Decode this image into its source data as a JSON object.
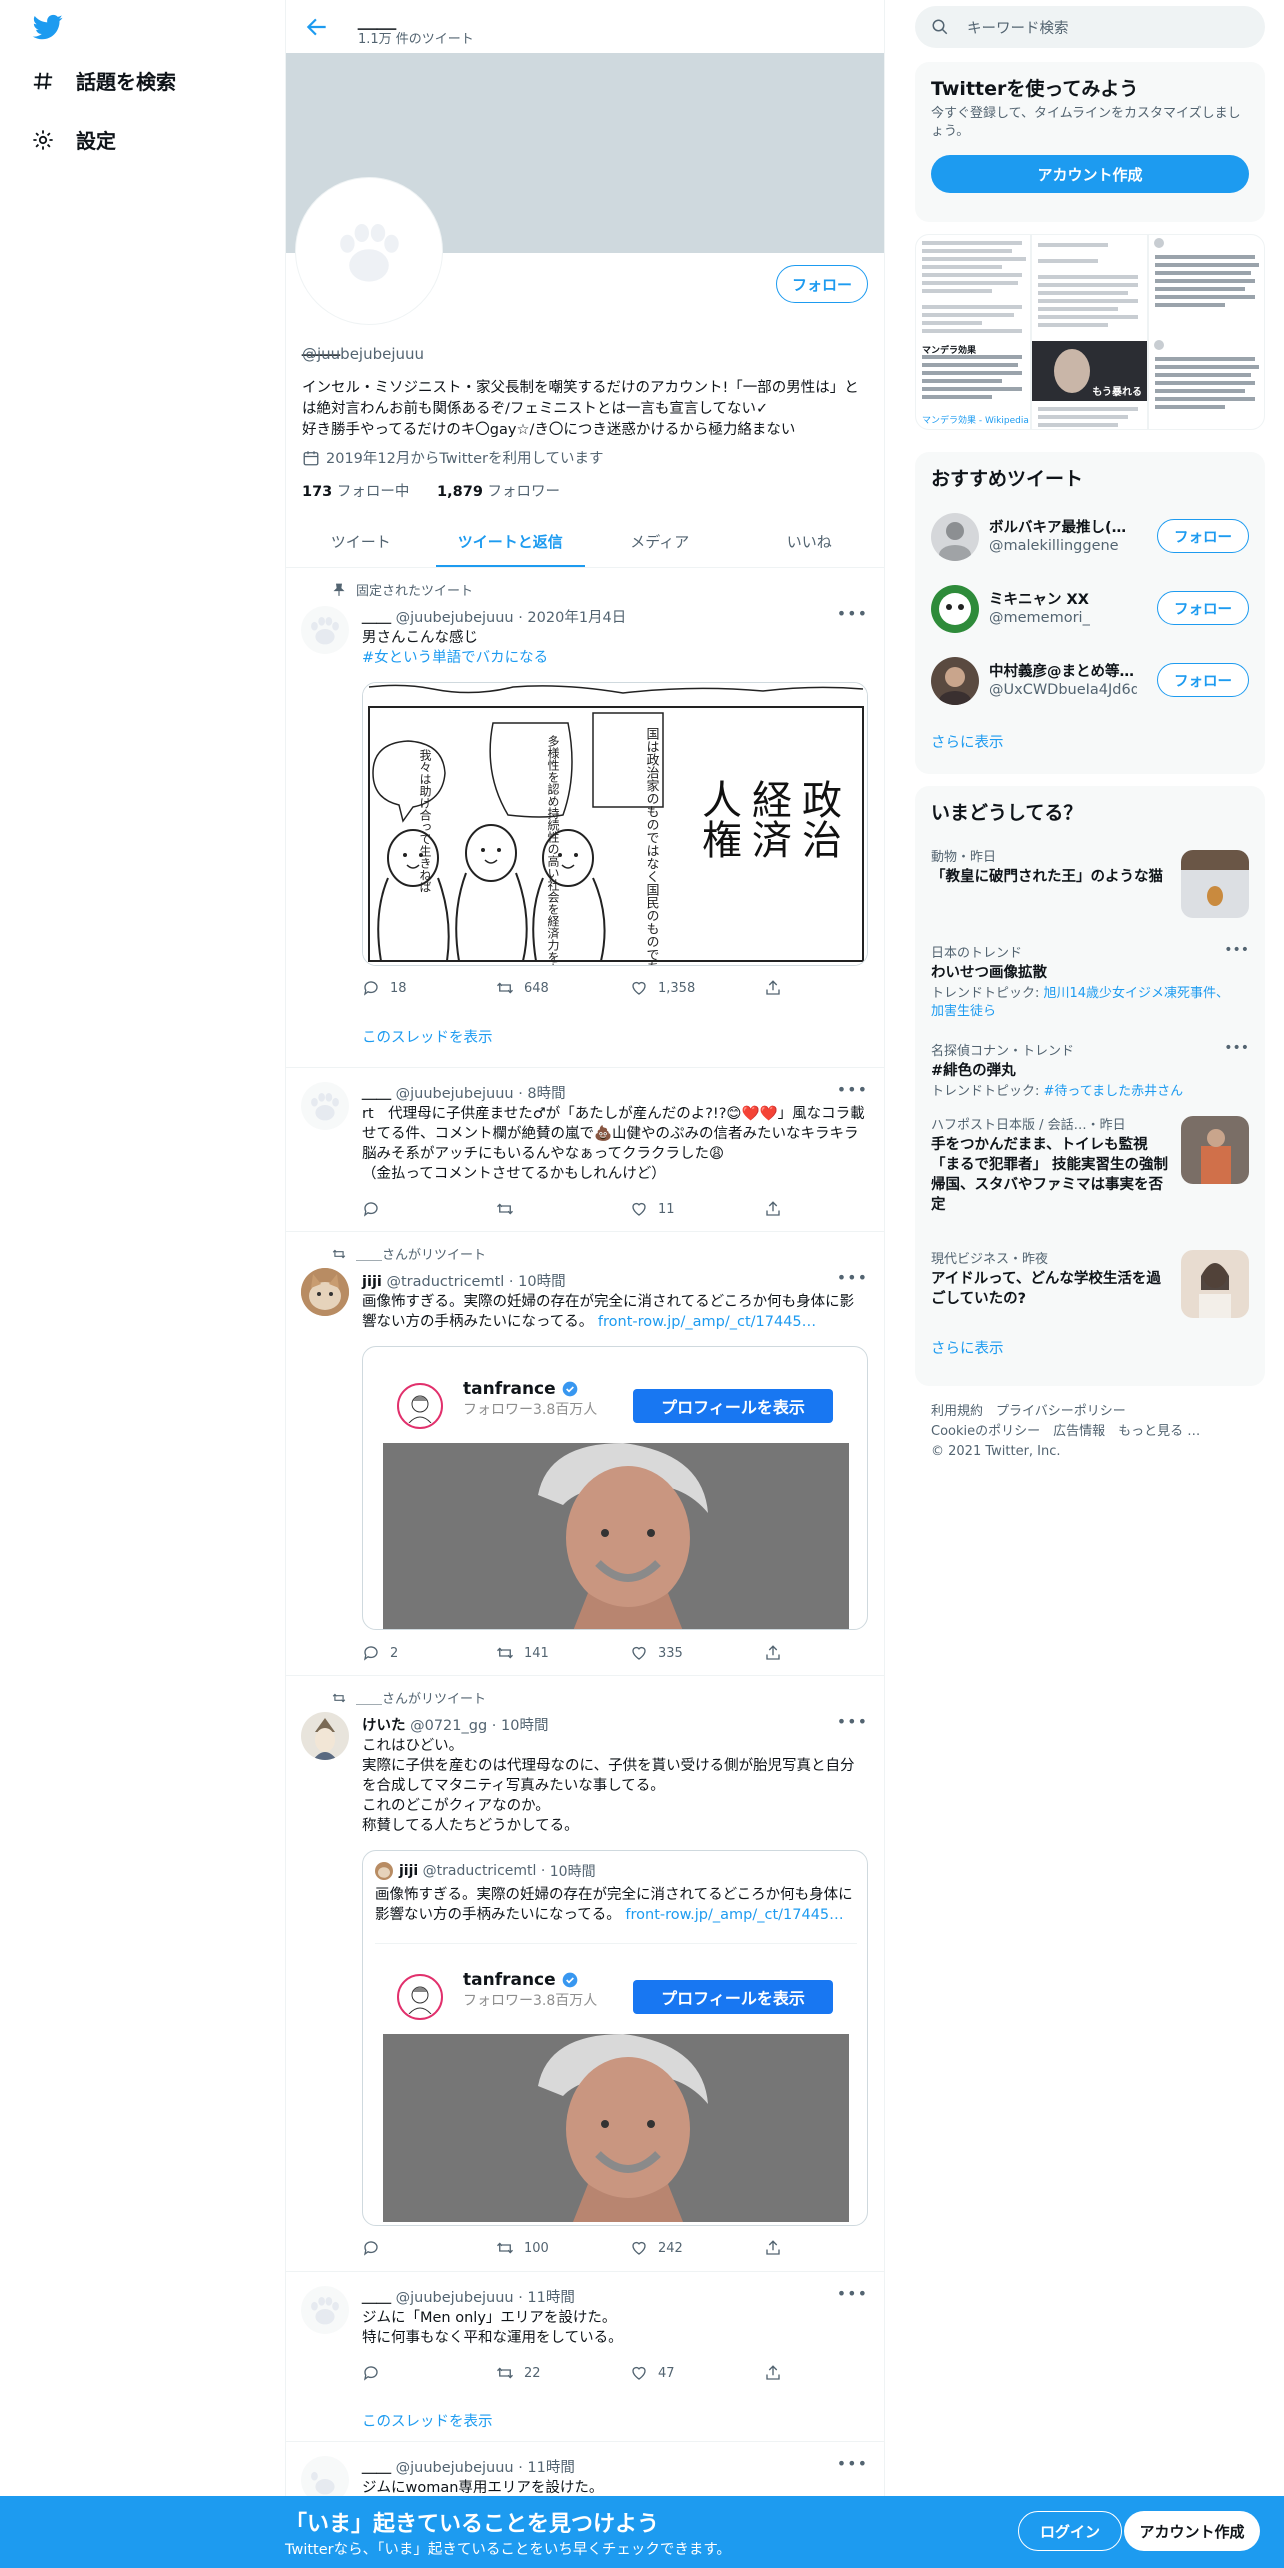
{
  "nav": {
    "explore_label": "話題を検索",
    "settings_label": "設定"
  },
  "header": {
    "name": "＿＿",
    "tweet_count": "1.1万 件のツイート"
  },
  "profile": {
    "follow_label": "フォロー",
    "name": "＿＿",
    "handle": "@juubejubejuuu",
    "bio": "インセル・ミソジニスト・家父長制を嘲笑するだけのアカウント!「一部の男性は」とは絶対言わんお前も関係あるぞ/フェミニストとは一言も宣言してない✓\n好き勝手やってるだけのキ〇gay☆/き〇につき迷惑かけるから極力絡まない",
    "joined": "2019年12月からTwitterを利用しています",
    "following_count": "173",
    "following_label": "フォロー中",
    "followers_count": "1,879",
    "followers_label": "フォロワー"
  },
  "tabs": [
    "ツイート",
    "ツイートと返信",
    "メディア",
    "いいね"
  ],
  "tweets": [
    {
      "context": "固定されたツイート",
      "name": "＿＿",
      "handle": "@juubejubejuuu",
      "time": "2020年1月4日",
      "text": "男さんこんな感じ",
      "hashtag": "#女という単語でバカになる",
      "replies": "18",
      "retweets": "648",
      "likes": "1,358",
      "thread_link": "このスレッドを表示",
      "image": {
        "big_text_col1": "政治",
        "big_text_col2": "経済",
        "big_text_col3": "人権",
        "bubble1": "国は政治家のものではなく国民のものである",
        "bubble2": "多様性を認め持続性の高い社会を経済力を上げる",
        "bubble3": "我々は助け合って生きねば"
      }
    },
    {
      "name": "＿＿",
      "handle": "@juubejubejuuu",
      "time": "8時間",
      "text": "rt　代理母に子供産ませた♂が「あたしが産んだのよ?!?😊❤️❤️」風なコラ載せてる件、コメント欄が絶賛の嵐で💩山健やのぷみの信者みたいなキラキラ脳みそ系がアッチにもいるんやなぁってクラクラした😩\n（金払ってコメントさせてるかもしれんけど）",
      "replies": "",
      "retweets": "",
      "likes": "11"
    },
    {
      "context": "＿＿さんがリツイート",
      "name": "jiji",
      "handle": "@traductricemtl",
      "time": "10時間",
      "text": "画像怖すぎる。実際の妊婦の存在が完全に消されてるどころか何も身体に影響ない方の手柄みたいになってる。",
      "link": "front-row.jp/_amp/_ct/17445…",
      "card_name": "tanfrance",
      "card_followers": "フォロワー3.8百万人",
      "card_button": "プロフィールを表示",
      "replies": "2",
      "retweets": "141",
      "likes": "335"
    },
    {
      "context": "＿＿さんがリツイート",
      "name": "けいた",
      "handle": "@0721_gg",
      "time": "10時間",
      "text": "これはひどい。\n実際に子供を産むのは代理母なのに、子供を貰い受ける側が胎児写真と自分を合成してマタニティ写真みたいな事してる。\nこれのどこがクィアなのか。\n称賛してる人たちどうかしてる。",
      "quote": {
        "name": "jiji",
        "handle": "@traductricemtl",
        "time": "10時間",
        "text": "画像怖すぎる。実際の妊婦の存在が完全に消されてるどころか何も身体に影響ない方の手柄みたいになってる。",
        "link": "front-row.jp/_amp/_ct/17445…",
        "card_name": "tanfrance",
        "card_followers": "フォロワー3.8百万人",
        "card_button": "プロフィールを表示"
      },
      "replies": "",
      "retweets": "100",
      "likes": "242"
    },
    {
      "name": "＿＿",
      "handle": "@juubejubejuuu",
      "time": "11時間",
      "text": "ジムに「Men only」エリアを設けた。\n特に何事もなく平和な運用をしている。",
      "replies": "",
      "retweets": "22",
      "likes": "47",
      "thread_link": "このスレッドを表示"
    },
    {
      "name": "＿＿",
      "handle": "@juubejubejuuu",
      "time": "11時間",
      "text": "ジムにwoman専用エリアを設けた。"
    }
  ],
  "right": {
    "search_placeholder": "キーワード検索",
    "signup_card": {
      "title": "Twitterを使ってみよう",
      "desc": "今すぐ登録して、タイムラインをカスタマイズしましょう。",
      "button": "アカウント作成"
    },
    "recommended": {
      "title": "おすすめツイート",
      "users": [
        {
          "name": "ボルバキア最推し(ボ…",
          "handle": "@malekillinggene",
          "button": "フォロー"
        },
        {
          "name": "ミキニャン XX",
          "handle": "@mememori_",
          "button": "フォロー"
        },
        {
          "name": "中村義彦@まとめ等…",
          "handle": "@UxCWDbueIa4Jd6q",
          "button": "フォロー"
        }
      ],
      "more": "さらに表示"
    },
    "trends": {
      "title": "いまどうしてる？",
      "items": [
        {
          "context": "動物・昨日",
          "title": "「教皇に破門された王」のような猫",
          "sub": ""
        },
        {
          "context": "日本のトレンド",
          "title": "わいせつ画像拡散",
          "sub": "トレンドトピック: ",
          "sub_link": "旭川14歳少女イジメ凍死事件、加害生徒ら"
        },
        {
          "context": "名探偵コナン・トレンド",
          "title": "#緋色の弾丸",
          "sub": "トレンドトピック: ",
          "sub_link": "#待ってました赤井さん"
        },
        {
          "context": "ハフポスト日本版 / 会話…・昨日",
          "title": "手をつかんだまま、トイレも監視「まるで犯罪者」 技能実習生の強制帰国、スタバやファミマは事実を否定",
          "sub": ""
        },
        {
          "context": "現代ビジネス・昨夜",
          "title": "アイドルって、どんな学校生活を過ごしていたの?",
          "sub": ""
        }
      ],
      "more": "さらに表示"
    },
    "footer": {
      "line1": "利用規約　プライバシーポリシー",
      "line2": "Cookieのポリシー　広告情報　もっと見る …",
      "line3": "© 2021 Twitter, Inc."
    },
    "collage": {
      "c1_head": "マンデラ効果",
      "c1_link": "マンデラ効果 - Wikipedia",
      "c2_text": "もう暴れる"
    }
  },
  "bottombar": {
    "title": "「いま」起きていることを見つけよう",
    "sub": "Twitterなら、「いま」起きていることをいち早くチェックできます。",
    "login": "ログイン",
    "signup": "アカウント作成"
  },
  "colors": {
    "accent": "#1d9bf0",
    "banner": "#cfd9de"
  }
}
